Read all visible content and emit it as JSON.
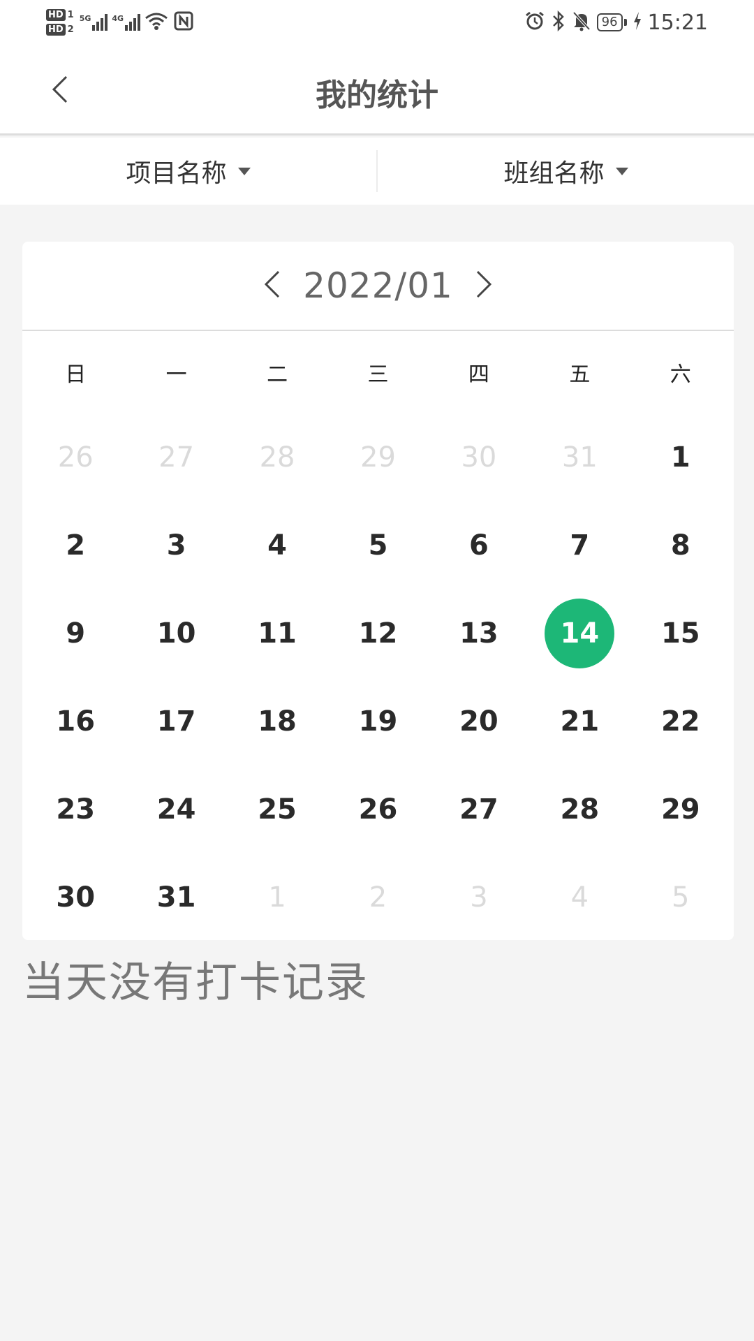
{
  "status_bar": {
    "hd1": "HD",
    "hd1_num": "1",
    "hd2": "HD",
    "hd2_num": "2",
    "net1": "5G",
    "net2": "4G",
    "battery": "96",
    "time": "15:21",
    "icons": [
      "alarm-icon",
      "bluetooth-icon",
      "mute-bell-icon",
      "charging-icon",
      "wifi-icon",
      "nfc-icon"
    ]
  },
  "header": {
    "title": "我的统计"
  },
  "filters": [
    {
      "label": "项目名称"
    },
    {
      "label": "班组名称"
    }
  ],
  "calendar": {
    "month": "2022/01",
    "weekdays": [
      "日",
      "一",
      "二",
      "三",
      "四",
      "五",
      "六"
    ],
    "selected_day": "14",
    "accent_color": "#1db777",
    "weeks": [
      [
        {
          "d": "26",
          "m": true
        },
        {
          "d": "27",
          "m": true
        },
        {
          "d": "28",
          "m": true
        },
        {
          "d": "29",
          "m": true
        },
        {
          "d": "30",
          "m": true
        },
        {
          "d": "31",
          "m": true
        },
        {
          "d": "1",
          "m": false
        }
      ],
      [
        {
          "d": "2",
          "m": false
        },
        {
          "d": "3",
          "m": false
        },
        {
          "d": "4",
          "m": false
        },
        {
          "d": "5",
          "m": false
        },
        {
          "d": "6",
          "m": false
        },
        {
          "d": "7",
          "m": false
        },
        {
          "d": "8",
          "m": false
        }
      ],
      [
        {
          "d": "9",
          "m": false
        },
        {
          "d": "10",
          "m": false
        },
        {
          "d": "11",
          "m": false
        },
        {
          "d": "12",
          "m": false
        },
        {
          "d": "13",
          "m": false
        },
        {
          "d": "14",
          "m": false
        },
        {
          "d": "15",
          "m": false
        }
      ],
      [
        {
          "d": "16",
          "m": false
        },
        {
          "d": "17",
          "m": false
        },
        {
          "d": "18",
          "m": false
        },
        {
          "d": "19",
          "m": false
        },
        {
          "d": "20",
          "m": false
        },
        {
          "d": "21",
          "m": false
        },
        {
          "d": "22",
          "m": false
        }
      ],
      [
        {
          "d": "23",
          "m": false
        },
        {
          "d": "24",
          "m": false
        },
        {
          "d": "25",
          "m": false
        },
        {
          "d": "26",
          "m": false
        },
        {
          "d": "27",
          "m": false
        },
        {
          "d": "28",
          "m": false
        },
        {
          "d": "29",
          "m": false
        }
      ],
      [
        {
          "d": "30",
          "m": false
        },
        {
          "d": "31",
          "m": false
        },
        {
          "d": "1",
          "m": true
        },
        {
          "d": "2",
          "m": true
        },
        {
          "d": "3",
          "m": true
        },
        {
          "d": "4",
          "m": true
        },
        {
          "d": "5",
          "m": true
        }
      ]
    ]
  },
  "empty_message": "当天没有打卡记录"
}
